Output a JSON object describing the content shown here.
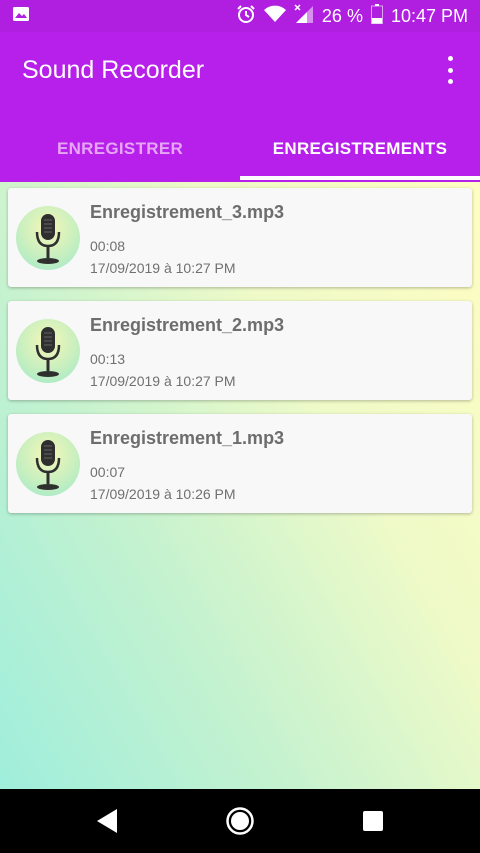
{
  "status_bar": {
    "icons": [
      "image-notification-icon",
      "alarm-icon",
      "wifi-icon",
      "cell-signal-icon",
      "battery-icon"
    ],
    "battery": "26 %",
    "time": "10:47 PM"
  },
  "app_bar": {
    "title": "Sound Recorder",
    "menu_icon": "more-vertical-icon"
  },
  "tabs": [
    {
      "label": "ENREGISTRER",
      "active": false
    },
    {
      "label": "ENREGISTREMENTS",
      "active": true
    }
  ],
  "recordings": [
    {
      "name": "Enregistrement_3.mp3",
      "duration": "00:08",
      "date": "17/09/2019 à 10:27 PM"
    },
    {
      "name": "Enregistrement_2.mp3",
      "duration": "00:13",
      "date": "17/09/2019 à 10:27 PM"
    },
    {
      "name": "Enregistrement_1.mp3",
      "duration": "00:07",
      "date": "17/09/2019 à 10:26 PM"
    }
  ],
  "nav_bar": {
    "buttons": [
      "back-icon",
      "home-icon",
      "recents-icon"
    ]
  },
  "colors": {
    "primary": "#b620ea",
    "status_bar": "#b01fe0",
    "inactive_tab": "#e7a5f6"
  }
}
